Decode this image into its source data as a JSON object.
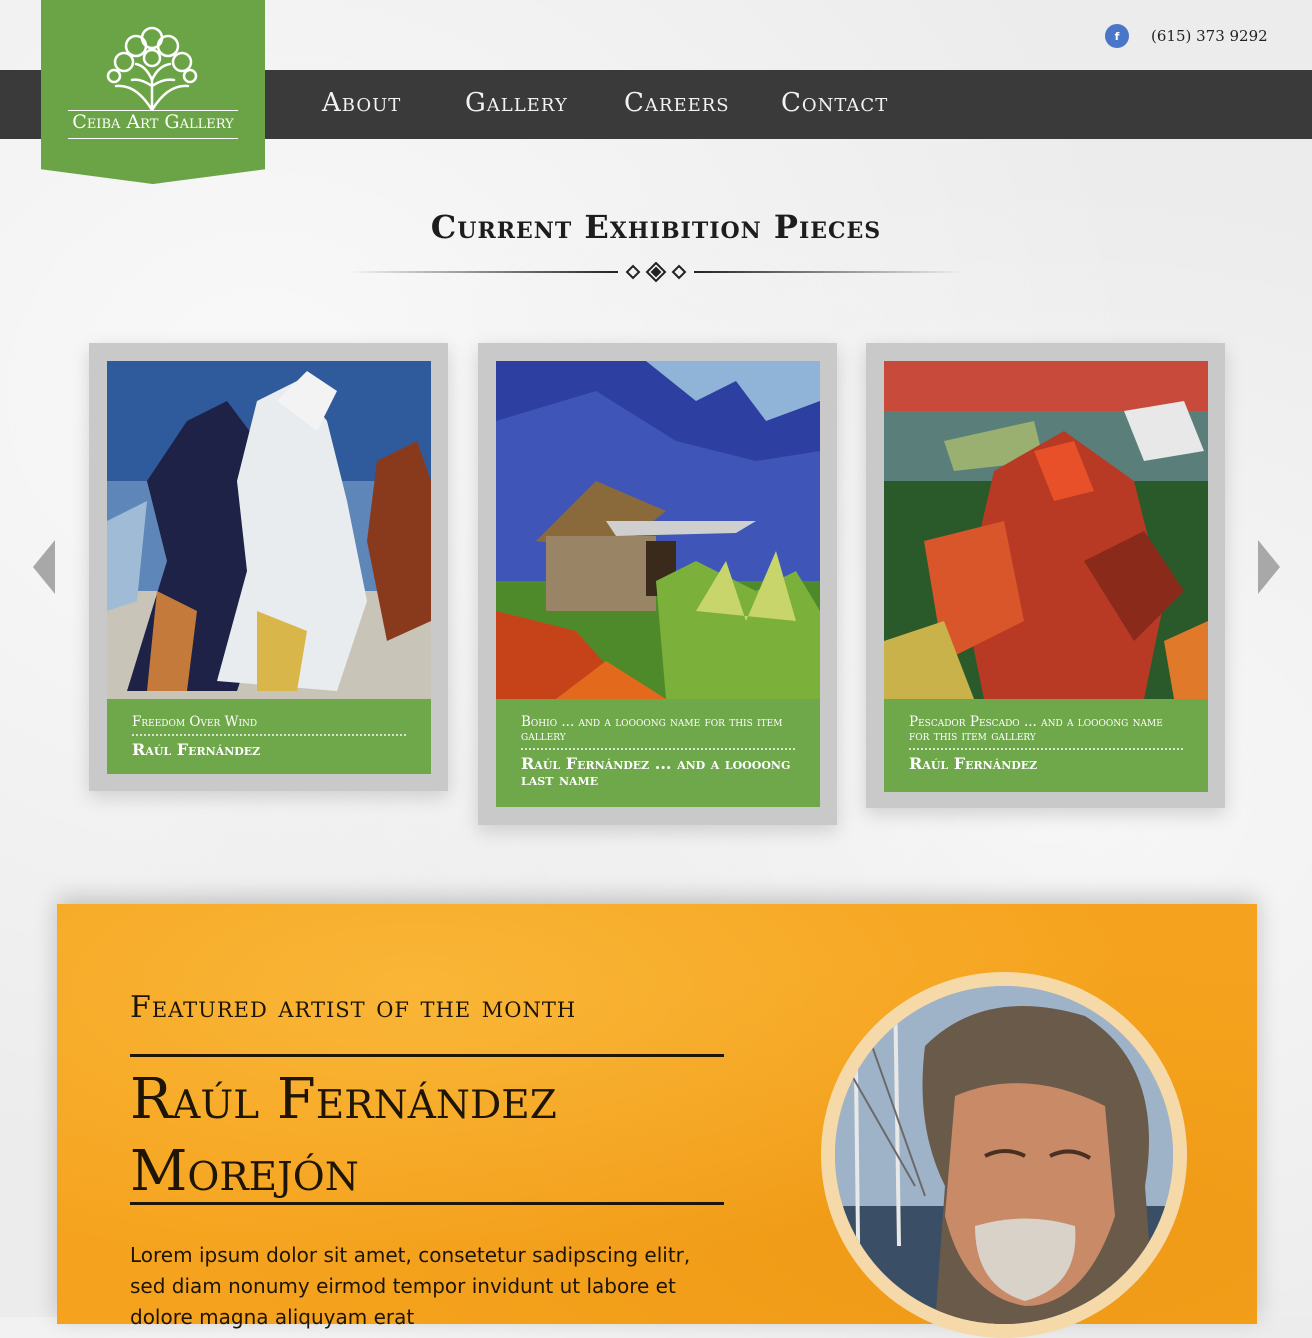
{
  "header": {
    "brand": "Ceiba Art Gallery",
    "phone": "(615) 373 9292",
    "social_icon": "facebook-icon",
    "social_glyph": "f",
    "nav": [
      "About",
      "Gallery",
      "Careers",
      "Contact"
    ]
  },
  "exhibition": {
    "title": "Current Exhibition Pieces",
    "cards": [
      {
        "title": "Freedom Over Wind",
        "artist": "Raúl Fernández"
      },
      {
        "title": "Bohio ... and a loooong name for this item gallery",
        "artist": "Raúl Fernández ... and a loooong last name"
      },
      {
        "title": "Pescador Pescado ... and a loooong name for this item gallery",
        "artist": "Raúl Fernández"
      }
    ]
  },
  "featured": {
    "label": "Featured artist of the month",
    "name_line1": "Raúl Fernández",
    "name_line2": "Morejón",
    "bio": "Lorem ipsum dolor sit amet, consetetur sadipscing elitr, sed diam nonumy eirmod tempor invidunt ut labore et dolore magna aliquyam erat"
  },
  "colors": {
    "brand_green": "#6ba446",
    "nav_bg": "#3a3a3a",
    "featured_orange": "#f5a31e"
  }
}
